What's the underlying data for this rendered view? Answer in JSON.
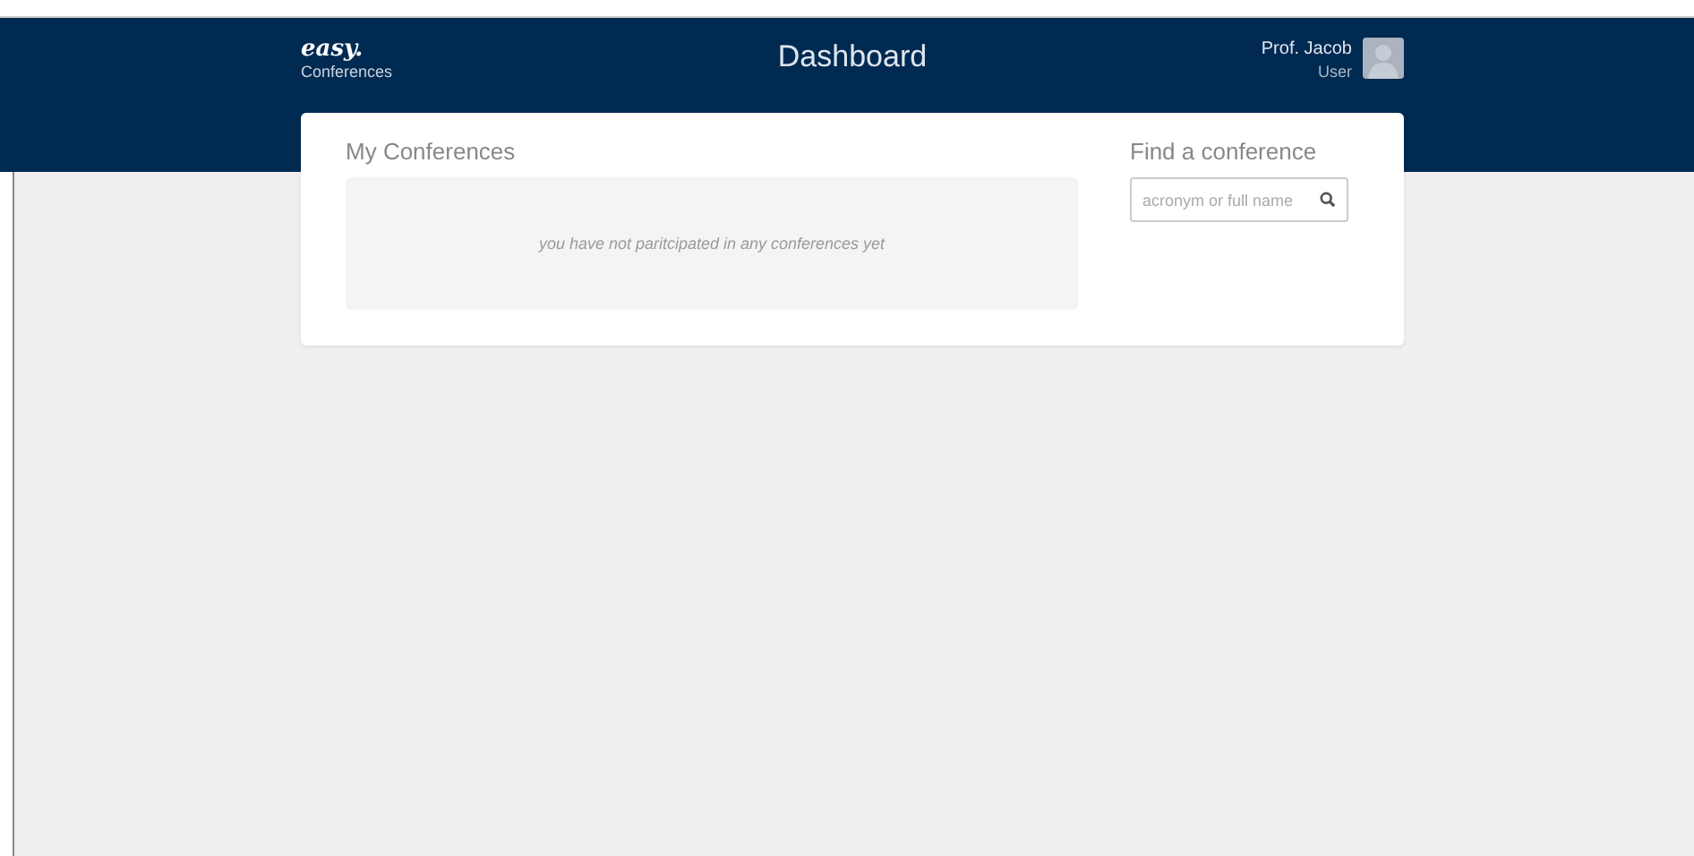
{
  "header": {
    "logo": "easy.",
    "logo_sub": "Conferences",
    "title": "Dashboard",
    "user": {
      "name": "Prof. Jacob",
      "role": "User"
    }
  },
  "my_conferences": {
    "title": "My Conferences",
    "empty_message": "you have not paritcipated in any conferences yet"
  },
  "find": {
    "title": "Find a conference",
    "search": {
      "placeholder": "acronym or full name"
    }
  }
}
